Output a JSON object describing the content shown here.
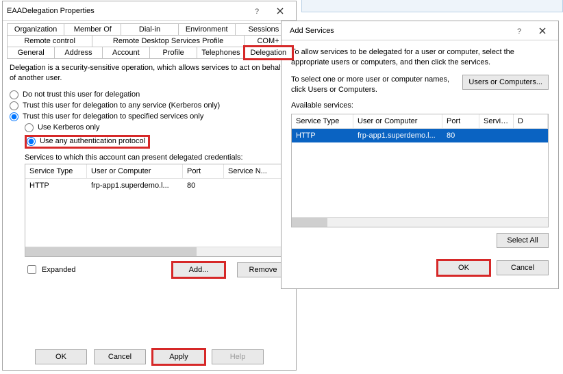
{
  "leftDialog": {
    "title": "EAADelegation Properties",
    "tabs": {
      "row1": [
        "Organization",
        "Member Of",
        "Dial-in",
        "Environment",
        "Sessions"
      ],
      "row2": [
        "Remote control",
        "Remote Desktop Services Profile",
        "COM+"
      ],
      "row3": [
        "General",
        "Address",
        "Account",
        "Profile",
        "Telephones",
        "Delegation"
      ]
    },
    "intro": "Delegation is a security-sensitive operation, which allows services to act on behalf of another user.",
    "radios": {
      "noTrust": "Do not trust this user for delegation",
      "anyService": "Trust this user for delegation to any service (Kerberos only)",
      "specified": "Trust this user for delegation to specified services only",
      "kerberosOnly": "Use Kerberos only",
      "anyAuth": "Use any authentication protocol"
    },
    "caption": "Services to which this account can present delegated credentials:",
    "columns": {
      "serviceType": "Service Type",
      "userOrComputer": "User or Computer",
      "port": "Port",
      "serviceName": "Service N..."
    },
    "rows": [
      {
        "serviceType": "HTTP",
        "userOrComputer": "frp-app1.superdemo.l...",
        "port": "80",
        "serviceName": ""
      }
    ],
    "expanded": "Expanded",
    "buttons": {
      "add": "Add...",
      "remove": "Remove",
      "ok": "OK",
      "cancel": "Cancel",
      "apply": "Apply",
      "help": "Help"
    }
  },
  "rightDialog": {
    "title": "Add Services",
    "intro": "To allow services to be delegated for a user or computer, select the appropriate users or computers, and then click the services.",
    "pickHint": "To select one or more user or computer names, click Users or Computers.",
    "usersBtn": "Users or Computers...",
    "availLabel": "Available services:",
    "columns": {
      "serviceType": "Service Type",
      "userOrComputer": "User or Computer",
      "port": "Port",
      "serviceName": "Service Name",
      "domain": "D"
    },
    "rows": [
      {
        "serviceType": "HTTP",
        "userOrComputer": "frp-app1.superdemo.l...",
        "port": "80",
        "serviceName": "",
        "domain": ""
      }
    ],
    "selectAll": "Select All",
    "ok": "OK",
    "cancel": "Cancel"
  }
}
